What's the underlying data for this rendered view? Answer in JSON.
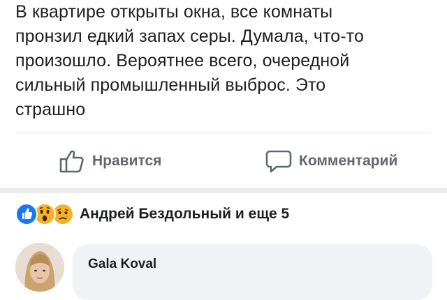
{
  "post": {
    "lines": [
      "В квартире открыты окна, все комнаты",
      "пронзил едкий запах серы. Думала, что-то",
      "произошло. Вероятнее всего, очередной",
      "сильный промышленный выброс. Это",
      "страшно"
    ]
  },
  "actions": {
    "like_label": "Нравится",
    "comment_label": "Комментарий",
    "like_icon": "thumbs-up-outline-icon",
    "comment_icon": "speech-bubble-outline-icon"
  },
  "reactions": {
    "icons": [
      "like-reaction",
      "wow-reaction",
      "sad-reaction"
    ],
    "summary": "Андрей Бездольный и еще 5",
    "colors": {
      "like": "#1877f2",
      "emoji": "#f7b125"
    }
  },
  "comment": {
    "author": "Gala Koval"
  }
}
